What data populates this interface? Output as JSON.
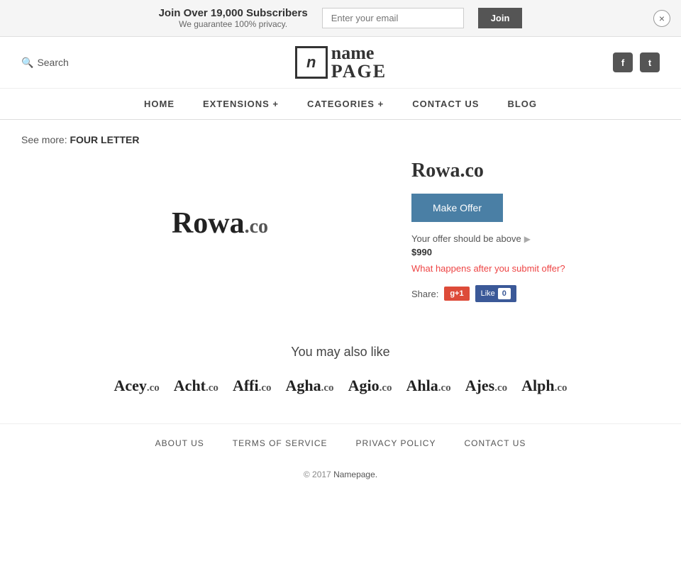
{
  "banner": {
    "headline": "Join Over 19,000 Subscribers",
    "subtext": "We guarantee 100% privacy.",
    "email_placeholder": "Enter your email",
    "join_label": "Join",
    "close_icon": "×"
  },
  "header": {
    "search_label": "Search",
    "logo_icon": "n",
    "logo_name": "name",
    "logo_page": "PAGE",
    "facebook_icon": "f",
    "twitter_icon": "t"
  },
  "nav": {
    "items": [
      {
        "label": "HOME",
        "id": "home"
      },
      {
        "label": "EXTENSIONS +",
        "id": "extensions"
      },
      {
        "label": "CATEGORIES +",
        "id": "categories"
      },
      {
        "label": "CONTACT US",
        "id": "contact"
      },
      {
        "label": "BLOG",
        "id": "blog"
      }
    ]
  },
  "breadcrumb": {
    "prefix": "See more:",
    "link": "FOUR LETTER"
  },
  "domain": {
    "name": "Rowa",
    "ext": ".co",
    "full": "Rowa.co",
    "make_offer_label": "Make Offer",
    "offer_hint": "Your offer should be above",
    "offer_amount": "$990",
    "offer_link": "What happens after you submit offer?",
    "share_label": "Share:",
    "gplus_label": "g+1",
    "fb_like_label": "Like",
    "fb_count": "0"
  },
  "also_like": {
    "title": "You may also like",
    "items": [
      {
        "name": "Acey",
        "ext": ".co"
      },
      {
        "name": "Acht",
        "ext": ".co"
      },
      {
        "name": "Affi",
        "ext": ".co"
      },
      {
        "name": "Agha",
        "ext": ".co"
      },
      {
        "name": "Agio",
        "ext": ".co"
      },
      {
        "name": "Ahla",
        "ext": ".co"
      },
      {
        "name": "Ajes",
        "ext": ".co"
      },
      {
        "name": "Alph",
        "ext": ".co"
      }
    ]
  },
  "footer": {
    "links": [
      {
        "label": "ABOUT US",
        "id": "about"
      },
      {
        "label": "TERMS OF SERVICE",
        "id": "terms"
      },
      {
        "label": "PRIVACY POLICY",
        "id": "privacy"
      },
      {
        "label": "CONTACT US",
        "id": "contact"
      }
    ],
    "copy": "© 2017",
    "brand": "Namepage.",
    "period": ""
  }
}
